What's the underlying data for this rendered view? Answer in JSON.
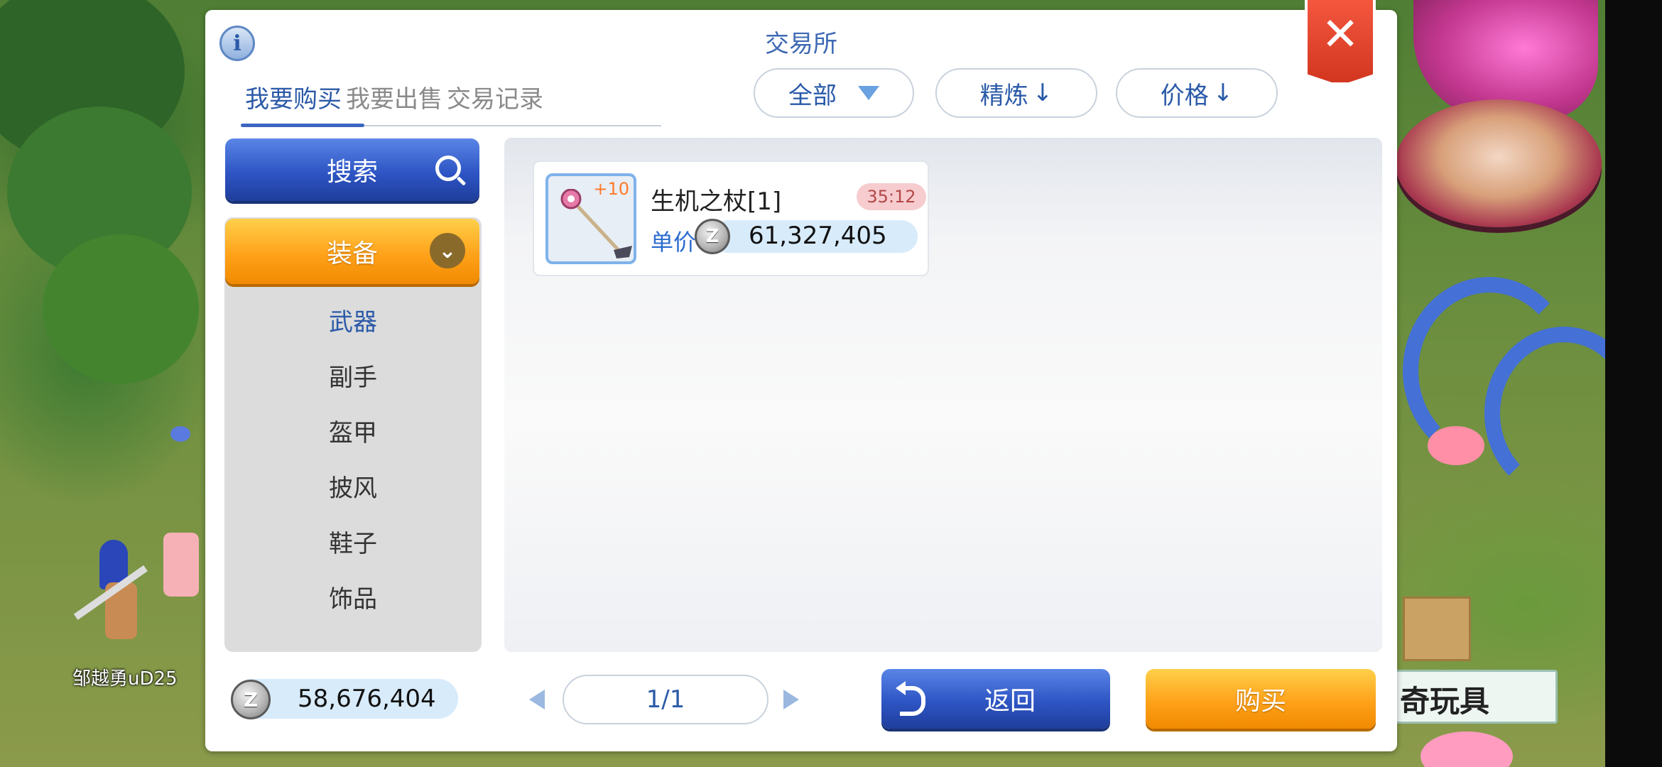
{
  "window": {
    "title": "交易所"
  },
  "tabs": [
    {
      "label": "我要购买",
      "active": true
    },
    {
      "label": "我要出售",
      "active": false
    },
    {
      "label": "交易记录",
      "active": false
    }
  ],
  "filters": {
    "type": {
      "label": "全部"
    },
    "refine_sort": {
      "label": "精炼",
      "arrow": "↓"
    },
    "price_sort": {
      "label": "价格",
      "arrow": "↓"
    }
  },
  "sidebar": {
    "search_label": "搜索",
    "category_label": "装备",
    "subcategories": [
      {
        "label": "武器",
        "selected": true
      },
      {
        "label": "副手",
        "selected": false
      },
      {
        "label": "盔甲",
        "selected": false
      },
      {
        "label": "披风",
        "selected": false
      },
      {
        "label": "鞋子",
        "selected": false
      },
      {
        "label": "饰品",
        "selected": false
      }
    ]
  },
  "listings": [
    {
      "name": "生机之杖[1]",
      "refine": "+10",
      "timer": "35:12",
      "unit_price_label": "单价",
      "price": "61,327,405",
      "icon": "staff-icon"
    }
  ],
  "currency": {
    "symbol": "Z",
    "balance": "58,676,404"
  },
  "pagination": {
    "label": "1/1"
  },
  "actions": {
    "back_label": "返回",
    "buy_label": "购买"
  },
  "background": {
    "character_name": "邹越勇uD25",
    "sign_text": "奇玩具"
  },
  "colors": {
    "accent_blue": "#2c5aa8",
    "orange_button": "#ffa21a",
    "blue_button": "#2e55c4",
    "close_red": "#e2452b"
  }
}
